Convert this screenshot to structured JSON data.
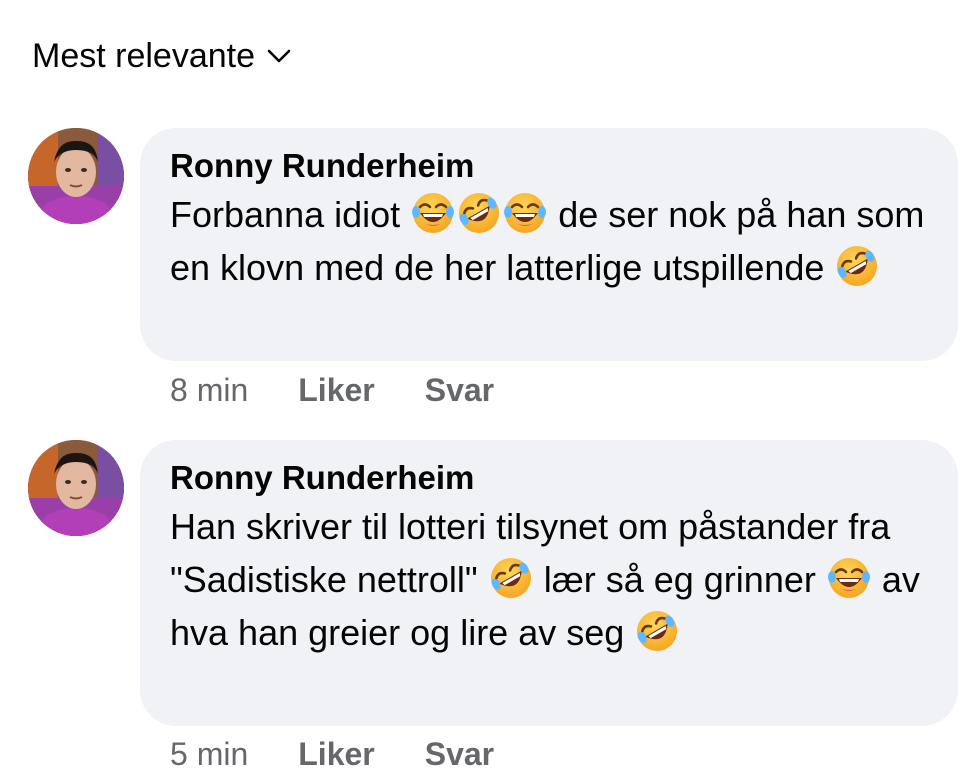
{
  "sort": {
    "label": "Mest relevante",
    "icon": "chevron-down-icon"
  },
  "comments": [
    {
      "author": "Ronny Runderheim",
      "segments": {
        "s1": "Forbanna idiot",
        "s2": "de ser nok på han som en klovn med de her latterlige utspillende"
      },
      "time": "8 min",
      "like_label": "Liker",
      "reply_label": "Svar"
    },
    {
      "author": "Ronny Runderheim",
      "segments": {
        "s1": "Han skriver til lotteri tilsynet om påstander fra \"Sadistiske nettroll\"",
        "s2": "lær så eg grinner",
        "s3": "av hva han greier og lire av seg"
      },
      "time": "5 min",
      "like_label": "Liker",
      "reply_label": "Svar"
    }
  ],
  "colors": {
    "bubble": "#f0f2f5",
    "meta_text": "#65676b",
    "emoji_face": "#fbbd2b"
  },
  "emoji": {
    "laughing": "tears-of-joy-emoji-icon",
    "rofl": "rolling-on-floor-laughing-emoji-icon"
  }
}
